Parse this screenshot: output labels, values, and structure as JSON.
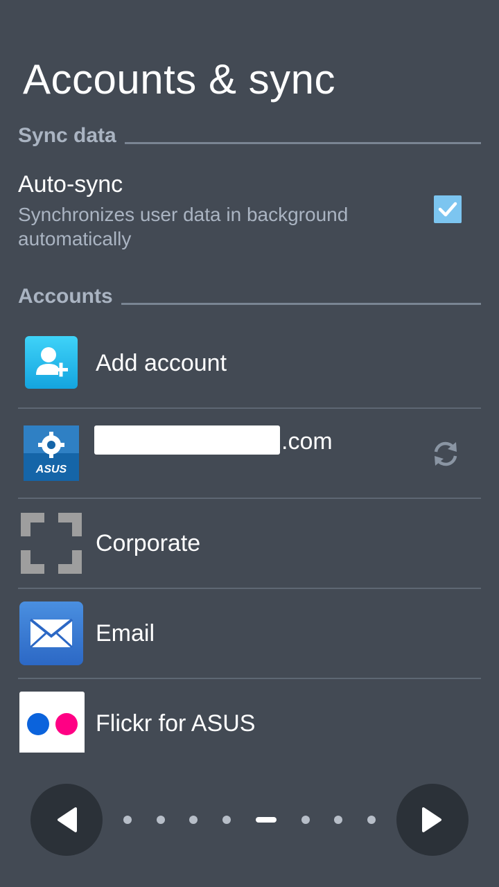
{
  "page": {
    "title": "Accounts & sync"
  },
  "sync_section": {
    "header": "Sync data",
    "auto_sync": {
      "title": "Auto-sync",
      "summary_line1": "Synchronizes user data in background",
      "summary_line2": "automatically",
      "checked": true
    }
  },
  "accounts_section": {
    "header": "Accounts",
    "items": [
      {
        "label": "Add account",
        "icon": "add-account-icon"
      },
      {
        "label": ".com",
        "icon": "asus-icon",
        "action_icon": "sync-icon"
      },
      {
        "label": "Corporate",
        "icon": "corporate-icon"
      },
      {
        "label": "Email",
        "icon": "email-icon"
      },
      {
        "label": "Flickr for ASUS",
        "icon": "flickr-icon"
      }
    ]
  },
  "pager": {
    "prev_icon": "left-arrow-icon",
    "next_icon": "right-arrow-icon",
    "pages": 8,
    "current_page": 5
  },
  "colors": {
    "background": "#434a54",
    "accent_checkbox": "#7cc5f0",
    "section_text": "#aab4c2"
  }
}
